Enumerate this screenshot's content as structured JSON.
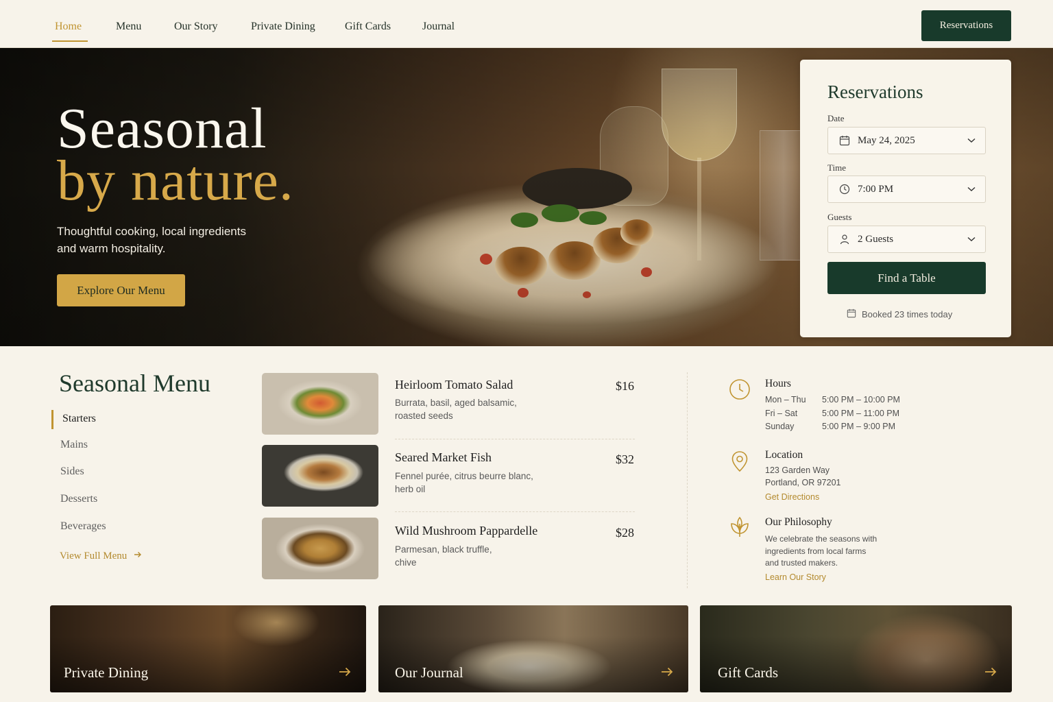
{
  "nav": {
    "items": [
      {
        "label": "Home",
        "active": true
      },
      {
        "label": "Menu"
      },
      {
        "label": "Our Story"
      },
      {
        "label": "Private Dining"
      },
      {
        "label": "Gift Cards"
      },
      {
        "label": "Journal"
      }
    ],
    "cta_label": "Reservations"
  },
  "hero": {
    "title_line1": "Seasonal",
    "title_line2": "by nature.",
    "subtitle_line1": "Thoughtful cooking, local ingredients",
    "subtitle_line2": "and warm hospitality.",
    "button_label": "Explore Our Menu"
  },
  "reservation": {
    "title": "Reservations",
    "date_label": "Date",
    "date_value": "May 24, 2025",
    "time_label": "Time",
    "time_value": "7:00 PM",
    "guests_label": "Guests",
    "guests_value": "2 Guests",
    "button_label": "Find a Table",
    "booked_text": "Booked 23 times today",
    "icons": {
      "date": "calendar-icon",
      "time": "clock-icon",
      "guests": "person-icon",
      "booked": "calendar-icon"
    }
  },
  "menu": {
    "title": "Seasonal Menu",
    "categories": [
      "Starters",
      "Mains",
      "Sides",
      "Desserts",
      "Beverages"
    ],
    "active_category": "Starters",
    "view_full_label": "View Full Menu",
    "dishes": [
      {
        "name": "Heirloom Tomato Salad",
        "desc_line1": "Burrata, basil, aged balsamic,",
        "desc_line2": "roasted seeds",
        "price": "$16"
      },
      {
        "name": "Seared Market Fish",
        "desc_line1": "Fennel purée, citrus beurre blanc,",
        "desc_line2": "herb oil",
        "price": "$32"
      },
      {
        "name": "Wild Mushroom Pappardelle",
        "desc_line1": "Parmesan, black truffle,",
        "desc_line2": "chive",
        "price": "$28"
      }
    ]
  },
  "info": {
    "hours": {
      "heading": "Hours",
      "rows": [
        {
          "days": "Mon – Thu",
          "time": "5:00 PM – 10:00 PM"
        },
        {
          "days": "Fri – Sat",
          "time": "5:00 PM – 11:00 PM"
        },
        {
          "days": "Sunday",
          "time": "5:00 PM – 9:00 PM"
        }
      ]
    },
    "location": {
      "heading": "Location",
      "line1": "123 Garden Way",
      "line2": "Portland, OR 97201",
      "link": "Get Directions"
    },
    "philosophy": {
      "heading": "Our Philosophy",
      "line1": "We celebrate the seasons with",
      "line2": "ingredients from local farms",
      "line3": "and trusted makers.",
      "link": "Learn Our Story"
    }
  },
  "cards": [
    {
      "label": "Private Dining"
    },
    {
      "label": "Our Journal"
    },
    {
      "label": "Gift Cards"
    }
  ],
  "colors": {
    "brand_green": "#183a2b",
    "accent_gold": "#c09431",
    "background": "#f7f3ea"
  }
}
